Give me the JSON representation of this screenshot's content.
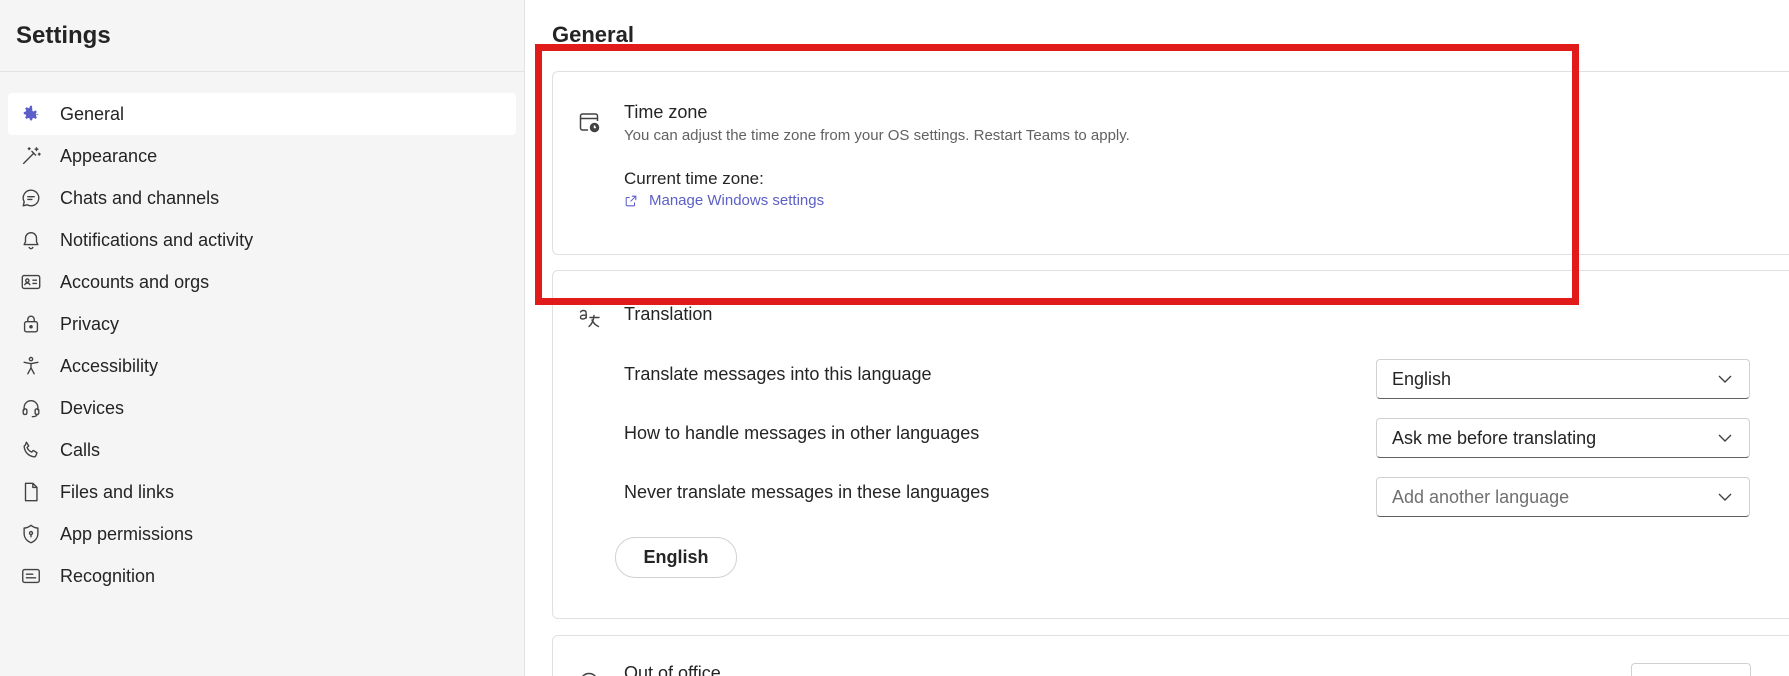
{
  "sidebar": {
    "title": "Settings",
    "items": [
      {
        "label": "General",
        "icon": "gear-icon",
        "active": true
      },
      {
        "label": "Appearance",
        "icon": "magic-wand-icon"
      },
      {
        "label": "Chats and channels",
        "icon": "chat-icon"
      },
      {
        "label": "Notifications and activity",
        "icon": "bell-icon"
      },
      {
        "label": "Accounts and orgs",
        "icon": "contact-card-icon"
      },
      {
        "label": "Privacy",
        "icon": "lock-icon"
      },
      {
        "label": "Accessibility",
        "icon": "accessibility-icon"
      },
      {
        "label": "Devices",
        "icon": "headset-icon"
      },
      {
        "label": "Calls",
        "icon": "phone-icon"
      },
      {
        "label": "Files and links",
        "icon": "document-icon"
      },
      {
        "label": "App permissions",
        "icon": "shield-icon"
      },
      {
        "label": "Recognition",
        "icon": "badge-icon"
      }
    ]
  },
  "main": {
    "title": "General",
    "time_zone": {
      "heading": "Time zone",
      "description": "You can adjust the time zone from your OS settings. Restart Teams to apply.",
      "current_label": "Current time zone:",
      "link_label": "Manage Windows settings"
    },
    "translation": {
      "heading": "Translation",
      "rows": [
        {
          "label": "Translate messages into this language",
          "value": "English",
          "placeholder": false
        },
        {
          "label": "How to handle messages in other languages",
          "value": "Ask me before translating",
          "placeholder": false
        },
        {
          "label": "Never translate messages in these languages",
          "value": "Add another language",
          "placeholder": true
        }
      ],
      "chip_label": "English"
    },
    "out_of_office": {
      "heading": "Out of office"
    }
  },
  "colors": {
    "accent": "#5b5fc7",
    "highlight": "#e11a1a"
  }
}
